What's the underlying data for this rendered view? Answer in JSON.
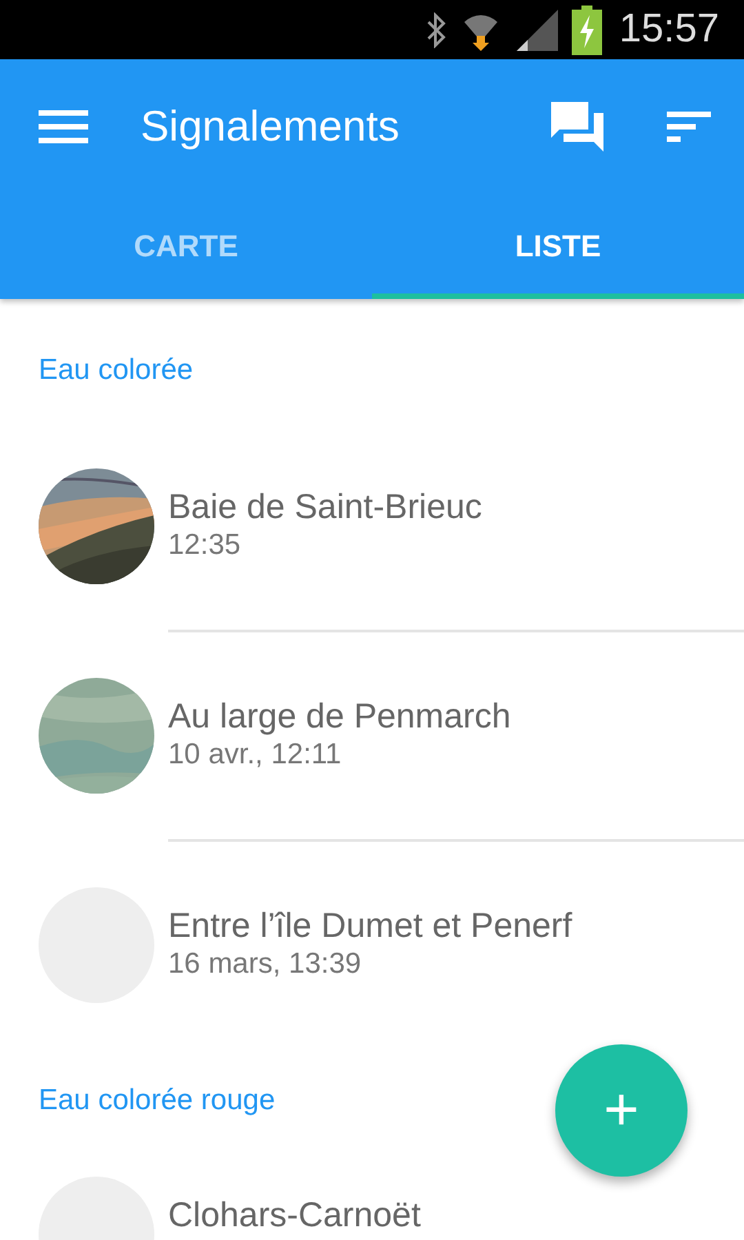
{
  "status_bar": {
    "time": "15:57"
  },
  "toolbar": {
    "title": "Signalements"
  },
  "tabs": [
    {
      "label": "CARTE",
      "selected": false
    },
    {
      "label": "LISTE",
      "selected": true
    }
  ],
  "sections": [
    {
      "header": "Eau colorée",
      "items": [
        {
          "kind": "picture",
          "title": "Baie de Saint-Brieuc",
          "subtitle": "12:35"
        },
        {
          "kind": "picture",
          "title": "Au large de Penmarch",
          "subtitle": "10 avr., 12:11"
        },
        {
          "kind": "placeholder",
          "title": "Entre l’île Dumet et Penerf",
          "subtitle": "16 mars, 13:39"
        }
      ]
    },
    {
      "header": "Eau colorée rouge",
      "items": [
        {
          "kind": "placeholder",
          "title": "Clohars-Carnoët"
        }
      ]
    }
  ],
  "fab": {
    "label": "+"
  }
}
